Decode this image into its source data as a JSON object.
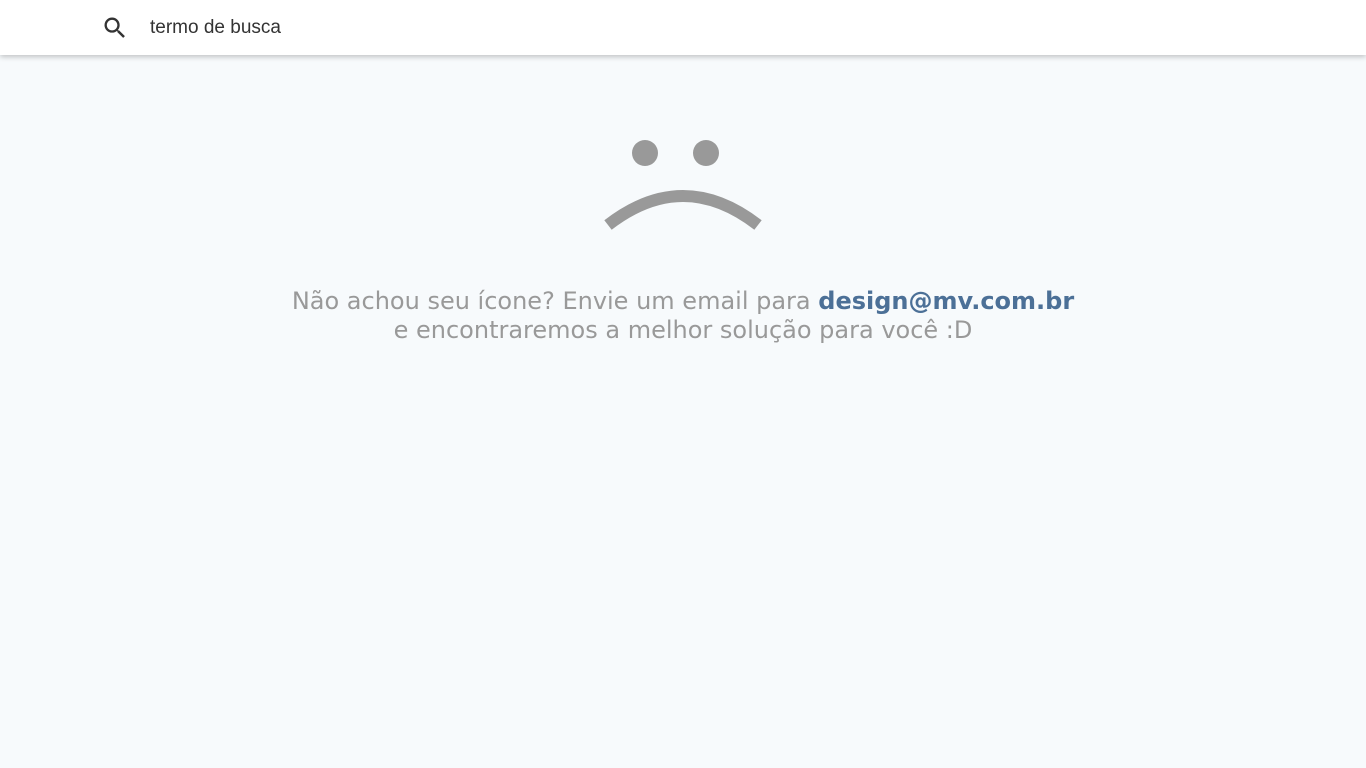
{
  "search": {
    "value": "termo de busca",
    "icon": "search-icon"
  },
  "empty_state": {
    "icon": "sad-face-icon",
    "line1_prefix": "Não achou seu ícone? Envie um email para ",
    "email": "design@mv.com.br",
    "line2": "e encontraremos a melhor solução para você :D"
  },
  "colors": {
    "background": "#f7fafc",
    "header": "#ffffff",
    "icon_gray": "#999999",
    "text_gray": "#999999",
    "link": "#4c7097"
  }
}
